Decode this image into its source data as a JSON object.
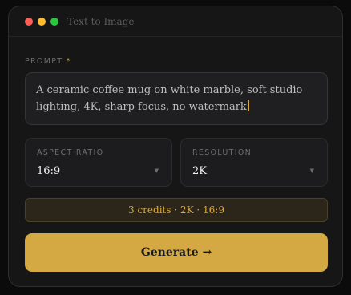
{
  "window": {
    "title": "Text to Image"
  },
  "prompt": {
    "label": "PROMPT",
    "required_mark": "*",
    "value": "A ceramic coffee mug on white marble, soft studio lighting, 4K, sharp focus, no watermark"
  },
  "aspect_ratio": {
    "label": "ASPECT RATIO",
    "value": "16:9",
    "icon": "chevron-down-icon"
  },
  "resolution": {
    "label": "RESOLUTION",
    "value": "2K",
    "icon": "chevron-down-icon"
  },
  "credits": {
    "text": "3 credits · 2K · 16:9"
  },
  "generate": {
    "label": "Generate →"
  },
  "colors": {
    "accent": "#d4a843",
    "window_bg": "#161617",
    "dot_red": "#ff5f57",
    "dot_yellow": "#febc2e",
    "dot_green": "#28c840"
  }
}
